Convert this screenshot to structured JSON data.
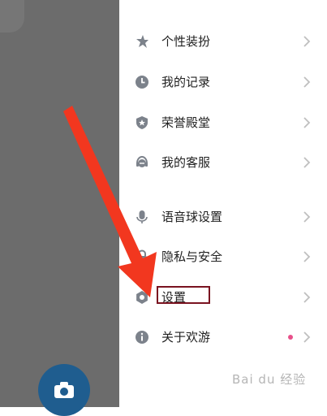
{
  "menu": {
    "items": [
      {
        "label": "个性装扮",
        "icon": "star-icon"
      },
      {
        "label": "我的记录",
        "icon": "clock-icon"
      },
      {
        "label": "荣誉殿堂",
        "icon": "shield-icon"
      },
      {
        "label": "我的客服",
        "icon": "headset-icon"
      },
      {
        "label": "语音球设置",
        "icon": "microphone-icon"
      },
      {
        "label": "隐私与安全",
        "icon": "lock-icon"
      },
      {
        "label": "设置",
        "icon": "gear-icon"
      },
      {
        "label": "关于欢游",
        "icon": "info-icon"
      }
    ]
  },
  "colors": {
    "overlay": "#6c6c6c",
    "icon": "#7c828b",
    "chevron": "#bfbfbf",
    "badge_dot": "#e8508a",
    "arrow": "#f2371f",
    "highlight_box": "#7a1320",
    "camera_button": "#1f5d8f"
  },
  "watermark": {
    "text": "Bai du 经验"
  }
}
